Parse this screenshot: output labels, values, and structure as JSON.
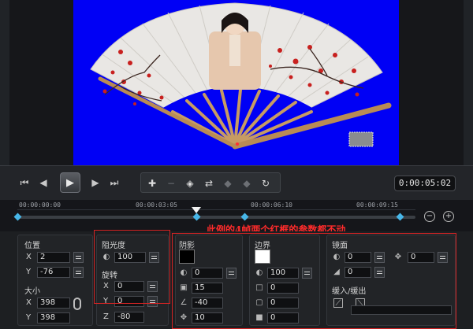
{
  "transport": {
    "timecode": "0:00:05:02",
    "buttons": [
      "go-to-start",
      "previous-frame",
      "play",
      "next-frame",
      "go-to-end"
    ]
  },
  "ruler": {
    "labels": [
      "00:00:00:00",
      "00:00:03:05",
      "00:00:06:10",
      "00:00:09:15"
    ],
    "keyframe_positions": [
      0.0,
      0.45,
      0.57,
      0.96
    ],
    "playhead_position": 0.45
  },
  "annotation": {
    "note": "此例的4帧两个红框的参数都不动"
  },
  "position": {
    "title": "位置",
    "x_label": "X",
    "x_value": "2",
    "y_label": "Y",
    "y_value": "-76"
  },
  "size": {
    "title": "大小",
    "x_label": "X",
    "x_value": "398",
    "y_label": "Y",
    "y_value": "398"
  },
  "opacity": {
    "title": "阻光度",
    "value": "100"
  },
  "rotation": {
    "title": "旋转",
    "x_label": "X",
    "x_value": "0",
    "y_label": "Y",
    "y_value": "0",
    "z_label": "Z",
    "z_value": "-80"
  },
  "shadow": {
    "title": "阴影",
    "color": "#000000",
    "value1": "0",
    "value2": "15",
    "value3": "-40",
    "value4": "10"
  },
  "border": {
    "title": "边界",
    "color": "#ffffff",
    "value1": "100",
    "value2": "0",
    "value3": "0",
    "value4": "0"
  },
  "mirror": {
    "title": "镜面",
    "value1": "0",
    "value2": "0",
    "value3": "0"
  },
  "ease": {
    "title": "缓入/缓出"
  },
  "colors": {
    "preview_bg": "#0000f5",
    "accent": "#47b6e8",
    "annotation": "#ff2b2b"
  }
}
